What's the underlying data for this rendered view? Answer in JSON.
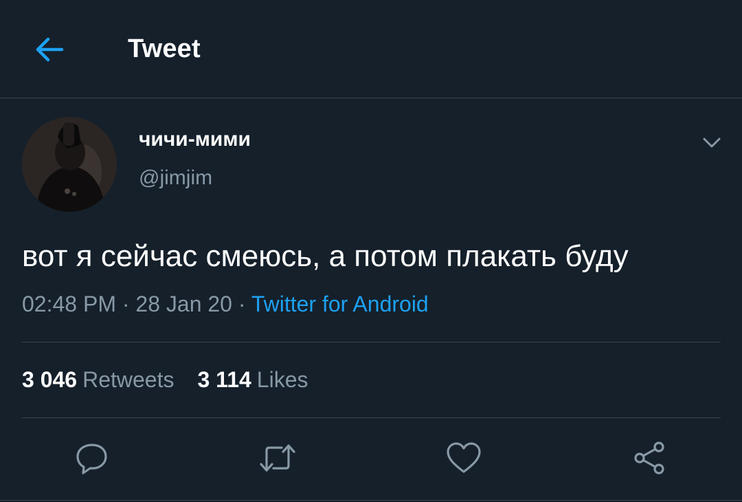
{
  "header": {
    "title": "Tweet",
    "back_icon": "arrow-left-icon"
  },
  "tweet": {
    "display_name": "чичи-мими",
    "handle": "@jimjim",
    "text": "вот я сейчас смеюсь, а потом плакать буду",
    "time": "02:48 PM",
    "separator": " · ",
    "date": "28 Jan 20",
    "source": "Twitter for Android",
    "caret_icon": "chevron-down-icon"
  },
  "stats": {
    "retweets_count": "3 046",
    "retweets_label": "Retweets",
    "likes_count": "3 114",
    "likes_label": "Likes"
  },
  "actions": {
    "reply_icon": "reply-icon",
    "retweet_icon": "retweet-icon",
    "like_icon": "heart-icon",
    "share_icon": "share-icon"
  },
  "colors": {
    "background": "#15202b",
    "accent": "#1da1f2",
    "secondary_text": "#8899a6",
    "divider": "#38444d"
  }
}
